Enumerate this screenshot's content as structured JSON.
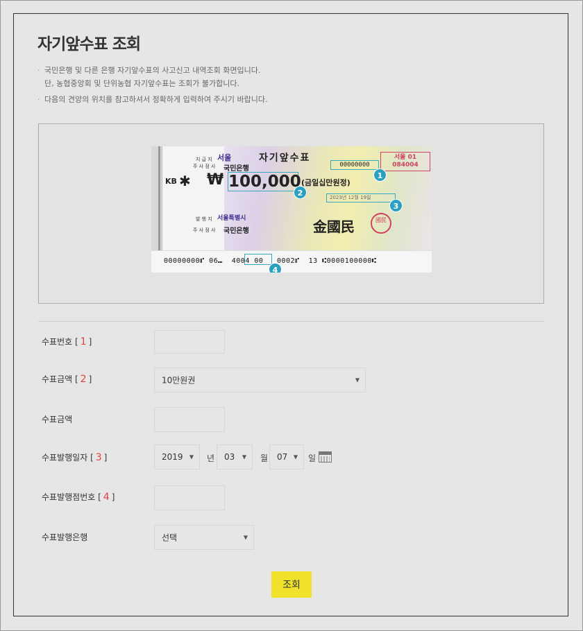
{
  "page": {
    "title": "자기앞수표 조회",
    "notes": [
      "국민은행 및 다른 은행 자기앞수표의 사고신고 내역조회 화면입니다.",
      "단, 농협중앙회 및 단위농협 자기앞수표는 조회가 불가합니다.",
      "다음의 견양의 위치를 참고하셔서 정확하게 입력하여 주시기 바랍니다."
    ]
  },
  "sample_check": {
    "title": "자기앞수표",
    "bank_city": "서울",
    "bank_name": "국민은행",
    "kb_logo": "KB",
    "currency_symbol": "₩",
    "amount": "100,000",
    "amount_words": "(금일십만원정)",
    "serial": "00000000",
    "stamp_lines": [
      "서울 01",
      "084004"
    ],
    "date_hint": "2023년 12월 19일",
    "issuer_city": "서울특별시",
    "hanja_name": "金國民",
    "seal_text": "國民",
    "micr_line": "00000000⑈ 06⑉  4004 00   0002⑈  13 ⑆0000100000⑆",
    "markers": [
      "1",
      "2",
      "3",
      "4"
    ]
  },
  "form": {
    "check_number": {
      "label": "수표번호",
      "num": "1",
      "value": ""
    },
    "check_amount_type": {
      "label": "수표금액",
      "num": "2",
      "selected": "10만원권"
    },
    "check_amount": {
      "label": "수표금액",
      "value": ""
    },
    "issue_date": {
      "label": "수표발행일자",
      "num": "3",
      "year": "2019",
      "year_unit": "년",
      "month": "03",
      "month_unit": "월",
      "day": "07",
      "day_unit": "일"
    },
    "branch_number": {
      "label": "수표발행점번호",
      "num": "4",
      "value": ""
    },
    "issuing_bank": {
      "label": "수표발행은행",
      "selected": "선택"
    }
  },
  "actions": {
    "search_label": "조회"
  },
  "colors": {
    "accent_button": "#f0e22a",
    "marker": "#2aa0c0",
    "required_number": "#e04040"
  }
}
